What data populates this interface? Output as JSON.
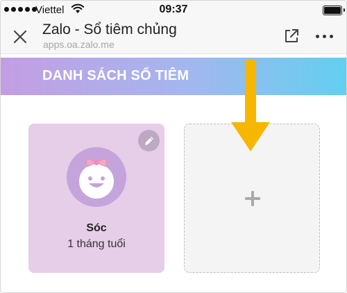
{
  "status_bar": {
    "carrier": "Viettel",
    "time": "09:37",
    "signal_bars": 5,
    "icons": [
      "signal-dots-icon",
      "wifi-icon",
      "battery-icon"
    ]
  },
  "nav": {
    "title": "Zalo - Sổ tiêm chủng",
    "subtitle": "apps.oa.zalo.me",
    "icons": [
      "close-icon",
      "open-external-icon",
      "more-dots-icon"
    ]
  },
  "banner": {
    "title": "DANH SÁCH SỔ TIÊM",
    "colors": [
      "#c39ee3",
      "#a3b7ef",
      "#62cff0"
    ]
  },
  "profiles": [
    {
      "name": "Sóc",
      "age": "1 tháng tuổi",
      "avatar_icon": "baby-girl-face-icon",
      "card_color": "#e6cde8",
      "avatar_color": "#c5a4db"
    }
  ],
  "add_card": {
    "icon": "plus-icon"
  },
  "annotation": {
    "icon": "arrow-down-icon",
    "color": "#f7b600"
  }
}
